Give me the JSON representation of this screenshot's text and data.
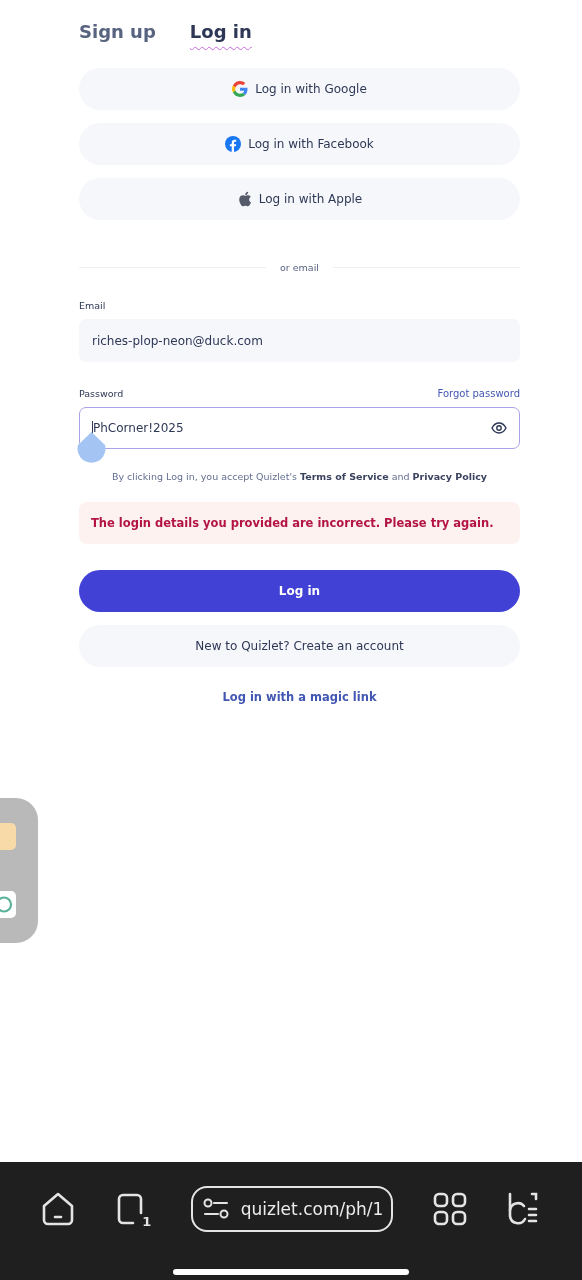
{
  "tabs": [
    {
      "label": "Sign up",
      "selected": false
    },
    {
      "label": "Log in",
      "selected": true
    }
  ],
  "social_buttons": [
    {
      "kind": "google",
      "label": "Log in with Google"
    },
    {
      "kind": "facebook",
      "label": "Log in with Facebook"
    },
    {
      "kind": "apple",
      "label": "Log in with Apple"
    }
  ],
  "divider_label": "or email",
  "email": {
    "label": "Email",
    "value": "riches-plop-neon@duck.com",
    "focused": false
  },
  "password": {
    "label": "Password",
    "forgot_link": "Forgot password",
    "value": "PhCorner!2025",
    "focused": true
  },
  "terms": {
    "text": "By clicking Log in, you accept Quizlet's",
    "terms_link": "Terms of Service",
    "joiner": "and",
    "policy_link": "Privacy Policy"
  },
  "error_message": "The login details you provided are incorrect. Please try again.",
  "login_button": "Log in",
  "create_account_button": "New to Quizlet? Create an account",
  "magic_link": "Log in with a magic link",
  "browser_bar": {
    "tab_count": "1",
    "url": "quizlet.com/ph/1"
  }
}
